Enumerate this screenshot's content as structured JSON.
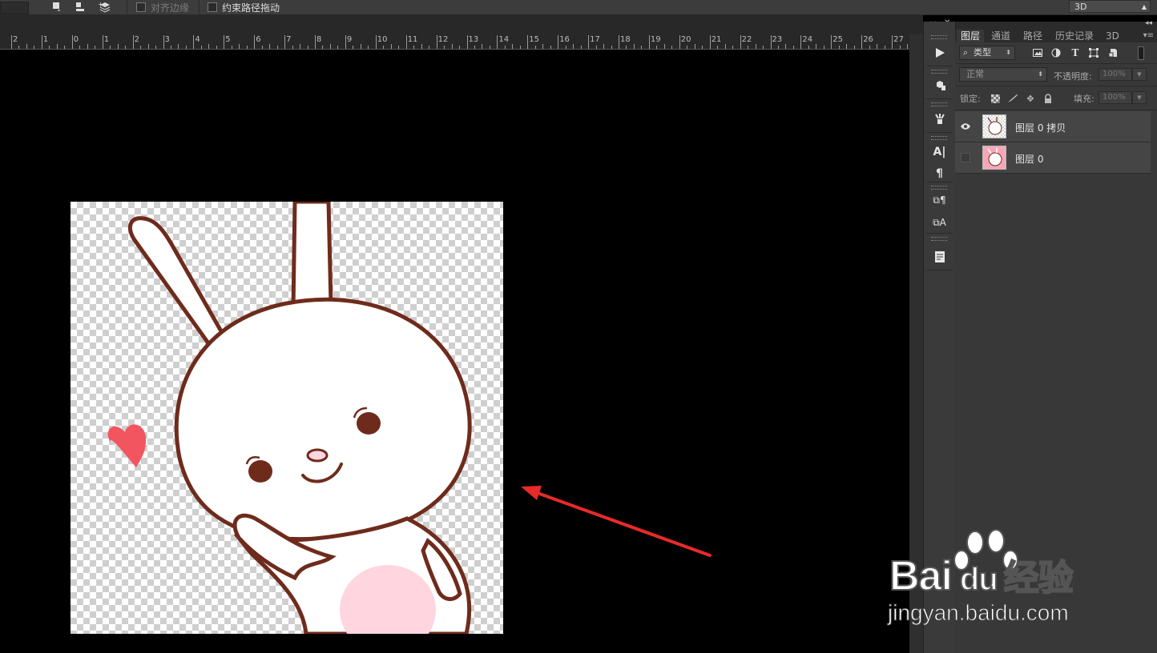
{
  "toolbar": {
    "align_edges_label": "对齐边缘",
    "constrain_path_label": "约束路径拖动",
    "workspace_select": "3D"
  },
  "ruler": {
    "labels": [
      "2",
      "1",
      "0",
      "1",
      "2",
      "3",
      "4",
      "5",
      "6",
      "7",
      "8",
      "9",
      "10",
      "11",
      "12",
      "13",
      "14",
      "15",
      "16",
      "17",
      "18",
      "19",
      "20",
      "21",
      "22",
      "23",
      "24",
      "25",
      "26",
      "27"
    ]
  },
  "layers_panel": {
    "tabs": [
      {
        "label": "图层",
        "active": true
      },
      {
        "label": "通道",
        "active": false
      },
      {
        "label": "路径",
        "active": false
      },
      {
        "label": "历史记录",
        "active": false
      },
      {
        "label": "3D",
        "active": false
      }
    ],
    "filter_label": "类型",
    "blend_mode": "正常",
    "opacity_label": "不透明度:",
    "opacity_value": "100%",
    "lock_label": "锁定:",
    "fill_label": "填充:",
    "fill_value": "100%",
    "layers": [
      {
        "name": "图层 0 拷贝",
        "visible": true
      },
      {
        "name": "图层 0",
        "visible": false
      }
    ]
  },
  "watermark": {
    "brand_left": "Bai",
    "brand_mid": "du",
    "brand_right": "经验",
    "url": "jingyan.baidu.com"
  },
  "colors": {
    "arrow": "#e82a2a",
    "outline": "#6e2b1c",
    "heart": "#f2555f",
    "belly": "#ffd6e0"
  }
}
